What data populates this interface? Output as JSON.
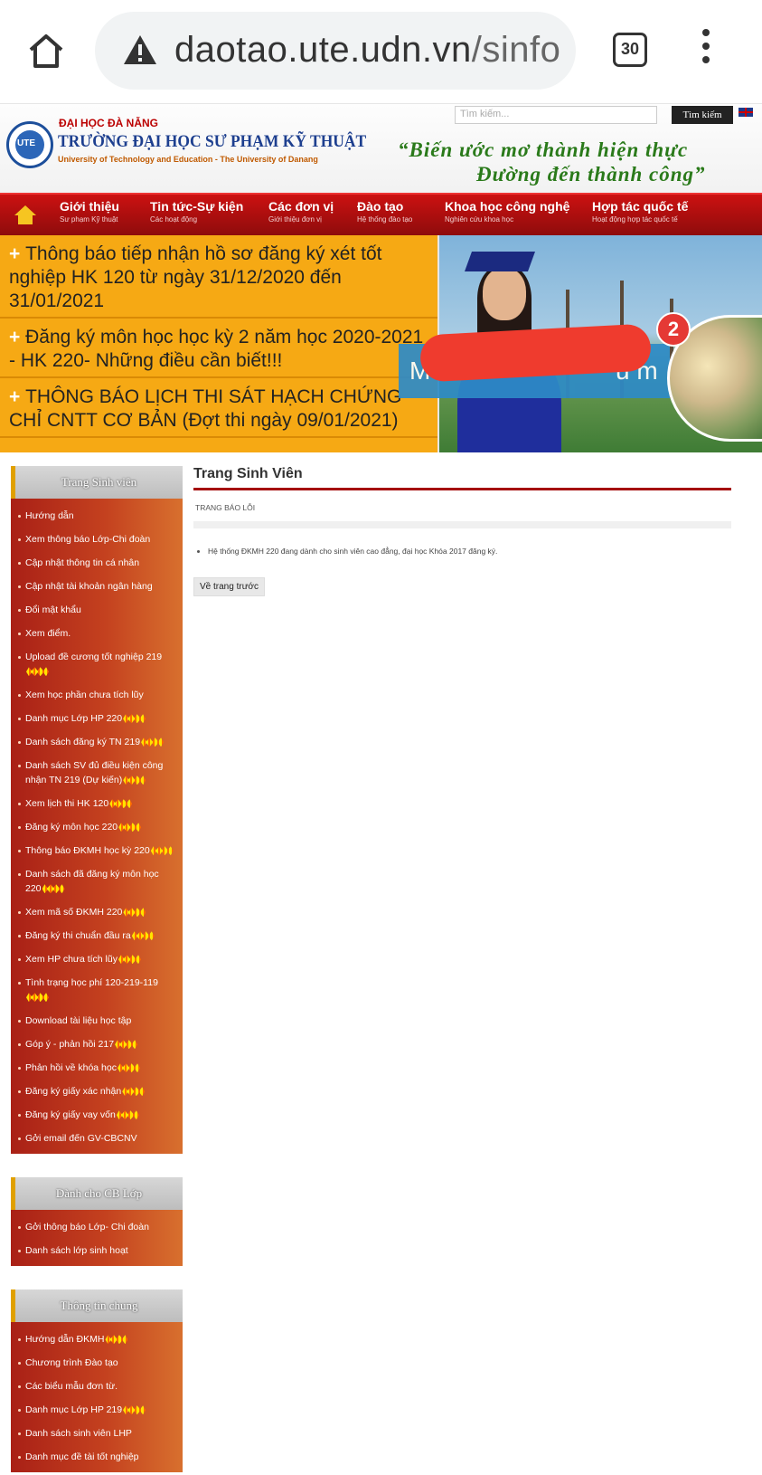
{
  "browser": {
    "url_host": "daotao.ute.udn.vn",
    "url_path": "/sinfo",
    "tab_count": "30"
  },
  "header": {
    "search_placeholder": "Tìm kiếm...",
    "search_button": "Tìm kiếm",
    "university_parent": "ĐẠI HỌC ĐÀ NẴNG",
    "university_name": "TRƯỜNG ĐẠI HỌC SƯ PHẠM KỸ THUẬT",
    "university_en": "University of Technology and Education - The University of Danang",
    "slogan_line1": "“Biến ước mơ thành hiện thực",
    "slogan_line2": "Đường đến thành công”"
  },
  "nav": [
    {
      "title": "Giới thiệu",
      "sub": "Sư phạm Kỹ thuật"
    },
    {
      "title": "Tin tức-Sự kiện",
      "sub": "Các hoạt động"
    },
    {
      "title": "Các đơn vị",
      "sub": "Giới thiệu đơn vị"
    },
    {
      "title": "Đào tạo",
      "sub": "Hệ thống đào tạo"
    },
    {
      "title": "Khoa học công nghệ",
      "sub": "Nghiên cứu khoa học"
    },
    {
      "title": "Hợp tác quốc tế",
      "sub": "Hoạt động hợp tác quốc tế"
    }
  ],
  "banner": {
    "news": [
      "Thông báo tiếp nhận hồ sơ đăng ký xét tốt nghiệp HK 120 từ ngày 31/12/2020 đến 31/01/2021",
      "Đăng ký môn học học kỳ 2 năm học 2020-2021 - HK 220- Những điều cần biết!!!",
      "THÔNG BÁO LỊCH THI SÁT HẠCH CHỨNG CHỈ CNTT CƠ BẢN (Đợt thi ngày 09/01/2021)"
    ],
    "overlay_left": "M",
    "overlay_right": "u m",
    "notification_count": "2"
  },
  "sidebar": {
    "sections": [
      {
        "title": "Trang Sinh viên",
        "items": [
          {
            "label": "Hướng dẫn",
            "new": false
          },
          {
            "label": "Xem thông báo Lớp-Chi đoàn",
            "new": false
          },
          {
            "label": "Cập nhật thông tin cá nhân",
            "new": false
          },
          {
            "label": "Cập nhật tài khoản ngân hàng",
            "new": false
          },
          {
            "label": "Đổi mật khẩu",
            "new": false
          },
          {
            "label": "Xem điểm.",
            "new": false
          },
          {
            "label": "Upload đề cương tốt nghiệp 219",
            "new": true
          },
          {
            "label": "Xem học phần chưa tích lũy",
            "new": false
          },
          {
            "label": "Danh mục Lớp HP 220",
            "new": true
          },
          {
            "label": "Danh sách đăng ký TN 219",
            "new": true
          },
          {
            "label": "Danh sách SV đủ điều kiện công nhận TN 219 (Dự kiến)",
            "new": true
          },
          {
            "label": "Xem lịch thi HK 120",
            "new": true
          },
          {
            "label": "Đăng ký môn học 220",
            "new": true
          },
          {
            "label": "Thông báo ĐKMH học kỳ 220",
            "new": true
          },
          {
            "label": "Danh sách đã đăng ký môn học 220",
            "new": true
          },
          {
            "label": "Xem mã số ĐKMH 220",
            "new": true
          },
          {
            "label": "Đăng ký thi chuẩn đầu ra",
            "new": true
          },
          {
            "label": "Xem HP chưa tích lũy",
            "new": true
          },
          {
            "label": "Tình trạng học phí 120-219-119",
            "new": true
          },
          {
            "label": "Download tài liệu học tập",
            "new": false
          },
          {
            "label": "Góp ý - phản hồi 217",
            "new": true
          },
          {
            "label": "Phản hồi về khóa học",
            "new": true
          },
          {
            "label": "Đăng ký giấy xác nhận",
            "new": true
          },
          {
            "label": "Đăng ký giấy vay vốn",
            "new": true
          },
          {
            "label": "Gởi email đến GV-CBCNV",
            "new": false
          }
        ]
      },
      {
        "title": "Dành cho CB Lớp",
        "items": [
          {
            "label": "Gởi thông báo Lớp- Chi đoàn",
            "new": false
          },
          {
            "label": "Danh sách lớp sinh hoạt",
            "new": false
          }
        ]
      },
      {
        "title": "Thông tin chung",
        "items": [
          {
            "label": "Hướng dẫn ĐKMH",
            "new": true
          },
          {
            "label": "Chương trình Đào tạo",
            "new": false
          },
          {
            "label": "Các biểu mẫu đơn từ.",
            "new": false
          },
          {
            "label": "Danh mục Lớp HP 219",
            "new": true
          },
          {
            "label": "Danh sách sinh viên LHP",
            "new": false
          },
          {
            "label": "Danh mục đề tài tốt nghiệp",
            "new": false
          }
        ]
      }
    ]
  },
  "main": {
    "title": "Trang Sinh Viên",
    "subtitle": "TRANG BÁO LỖI",
    "message": "Hệ thống ĐKMH 220 đang dành cho sinh viên cao đẳng, đại học Khóa 2017 đăng ký.",
    "back_button": "Về trang trước"
  },
  "colors": {
    "nav_red": "#a50e0e",
    "banner_orange": "#f6a914",
    "slogan_green": "#2a7a1a"
  }
}
